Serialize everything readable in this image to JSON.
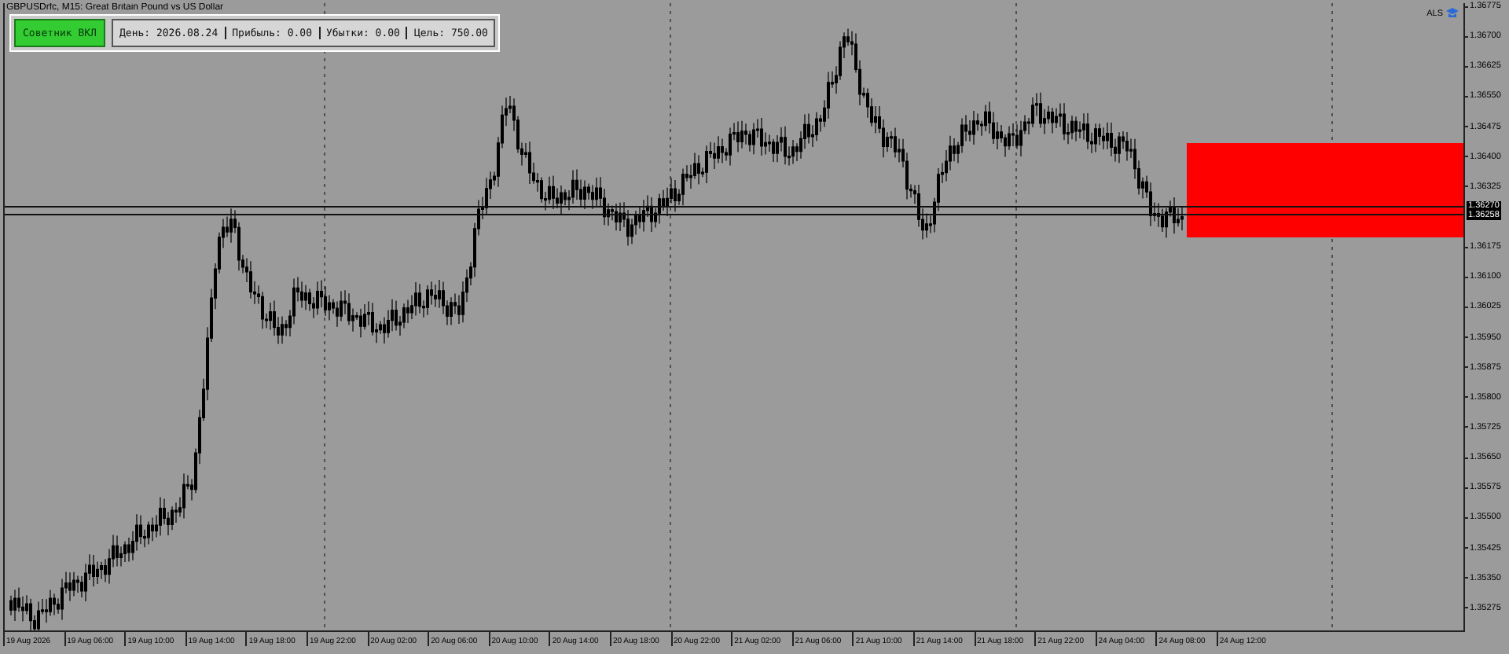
{
  "chart": {
    "symbol_title": "GBPUSDrfc, M15: Great Britain Pound vs US Dollar",
    "advisor_button": {
      "label": "Советник ВКЛ",
      "on": true
    },
    "info_panel": [
      "День: 2026.08.24",
      "Прибыль: 0.00",
      "Убытки: 0.00",
      "Цель: 750.00"
    ],
    "expert_label": "ALS",
    "price_tags": [
      "1.36270",
      "1.36258"
    ],
    "price_axis": [
      "1.36775",
      "1.36700",
      "1.36625",
      "1.36550",
      "1.36475",
      "1.36400",
      "1.36325",
      "1.36175",
      "1.36100",
      "1.36025",
      "1.35950",
      "1.35875",
      "1.35800",
      "1.35725",
      "1.35650",
      "1.35575",
      "1.35500",
      "1.35425",
      "1.35350",
      "1.35275"
    ],
    "time_axis": [
      "19 Aug 2026",
      "19 Aug 06:00",
      "19 Aug 10:00",
      "19 Aug 14:00",
      "19 Aug 18:00",
      "19 Aug 22:00",
      "20 Aug 02:00",
      "20 Aug 06:00",
      "20 Aug 10:00",
      "20 Aug 14:00",
      "20 Aug 18:00",
      "20 Aug 22:00",
      "21 Aug 02:00",
      "21 Aug 06:00",
      "21 Aug 10:00",
      "21 Aug 14:00",
      "21 Aug 18:00",
      "21 Aug 22:00",
      "24 Aug 04:00",
      "24 Aug 08:00",
      "24 Aug 12:00"
    ]
  }
}
